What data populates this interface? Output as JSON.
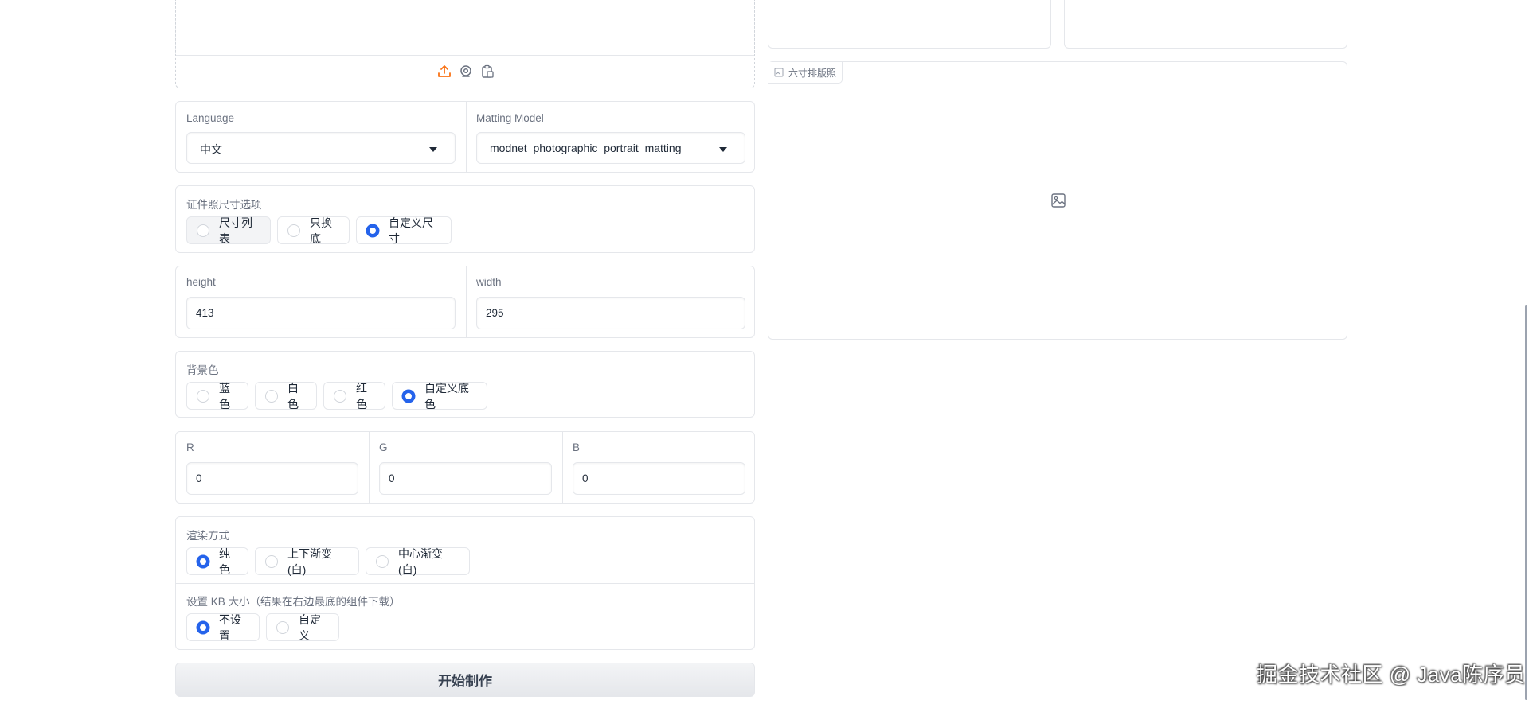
{
  "upload_toolbar": {
    "icons": [
      "upload-icon",
      "webcam-icon",
      "clipboard-icon"
    ]
  },
  "language": {
    "label": "Language",
    "value": "中文"
  },
  "matting_model": {
    "label": "Matting Model",
    "value": "modnet_photographic_portrait_matting"
  },
  "size_options": {
    "label": "证件照尺寸选项",
    "options": [
      "尺寸列表",
      "只换底",
      "自定义尺寸"
    ],
    "selected": "自定义尺寸"
  },
  "dimensions": {
    "height_label": "height",
    "height_value": "413",
    "width_label": "width",
    "width_value": "295"
  },
  "background_color": {
    "label": "背景色",
    "options": [
      "蓝色",
      "白色",
      "红色",
      "自定义底色"
    ],
    "selected": "自定义底色"
  },
  "rgb": {
    "r_label": "R",
    "r_value": "0",
    "g_label": "G",
    "g_value": "0",
    "b_label": "B",
    "b_value": "0"
  },
  "render_mode": {
    "label": "渲染方式",
    "options": [
      "纯色",
      "上下渐变(白)",
      "中心渐变(白)"
    ],
    "selected": "纯色"
  },
  "kb_size": {
    "label": "设置 KB 大小（结果在右边最底的组件下载）",
    "options": [
      "不设置",
      "自定义"
    ],
    "selected": "不设置"
  },
  "submit": {
    "label": "开始制作"
  },
  "six_inch_layout": {
    "label": "六寸排版照"
  },
  "watermark": {
    "text": "掘金技术社区 @ Java陈序员"
  },
  "colors": {
    "accent": "#2563eb",
    "upload_accent": "#f97316",
    "border": "#e5e7eb"
  }
}
